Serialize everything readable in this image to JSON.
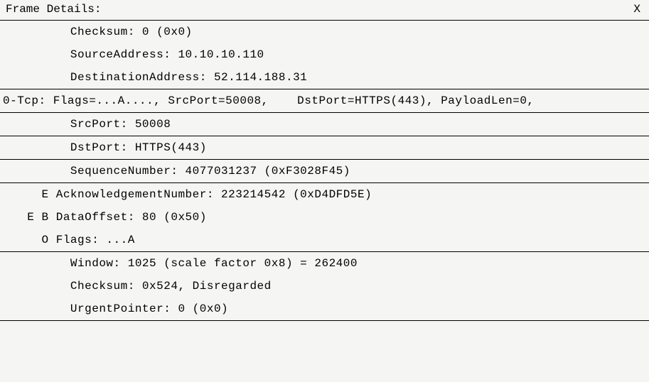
{
  "header": {
    "title": "Frame Details:",
    "close": "X"
  },
  "ip": {
    "checksum": "         Checksum: 0 (0x0)",
    "source_addr": "         SourceAddress: 10.10.10.110",
    "dest_addr": "         DestinationAddress: 52.114.188.31"
  },
  "tcp_summary": "0-Tcp: Flags=...A...., SrcPort=50008,    DstPort=HTTPS(443), PayloadLen=0,",
  "tcp": {
    "src_port": "         SrcPort: 50008",
    "dst_port": "         DstPort: HTTPS(443)",
    "sequence_number": "         SequenceNumber: 4077031237 (0xF3028F45)",
    "ack_number": "     E AcknowledgementNumber: 223214542 (0xD4DFD5E)",
    "data_offset": "   E B DataOffset: 80 (0x50)",
    "flags": "     O Flags: ...A",
    "window": "         Window: 1025 (scale factor 0x8) = 262400",
    "checksum": "         Checksum: 0x524, Disregarded",
    "urgent_pointer": "         UrgentPointer: 0 (0x0)"
  }
}
